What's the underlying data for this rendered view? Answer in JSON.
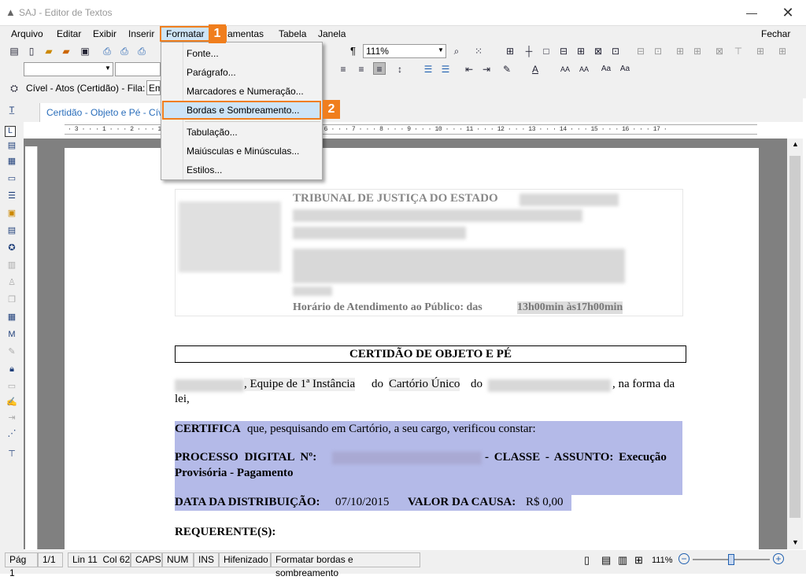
{
  "window": {
    "title": "SAJ - Editor de Textos"
  },
  "menus": [
    "Arquivo",
    "Editar",
    "Exibir",
    "Inserir",
    "Formatar",
    "Ferramentas",
    "Tabela",
    "Janela"
  ],
  "close_doc": "Fechar",
  "toolbar": {
    "zoom": "111%"
  },
  "filter": {
    "label": "Cível - Atos (Certidão) - Fila:",
    "value": "Em"
  },
  "tab": {
    "label": "Certidão - Objeto e Pé - Cíve"
  },
  "format_menu": {
    "items": [
      "Fonte...",
      "Parágrafo...",
      "Marcadores e Numeração...",
      "Bordas e Sombreamento...",
      "Tabulação...",
      "Maiúsculas e Minúsculas...",
      "Estilos..."
    ],
    "highlighted": "Bordas e Sombreamento..."
  },
  "callouts": [
    "1",
    "2"
  ],
  "document": {
    "court": "TRIBUNAL DE JUSTIÇA DO ESTADO",
    "hours_label": "Horário de Atendimento ao Público: das",
    "hours_value": "13h00min às17h00min",
    "title": "CERTIDÃO DE OBJETO E PÉ",
    "p1_a": ", Equipe de 1ª Instância",
    "p1_b": "do",
    "p1_c": "Cartório Único",
    "p1_d": "do",
    "p1_e": ", na forma da",
    "p1_f": "lei,",
    "cert_bold": "CERTIFICA",
    "cert_rest": " que, pesquisando em Cartório, a seu cargo, verificou constar:",
    "proc_label": "PROCESSO DIGITAL Nº:",
    "proc_rest": "- CLASSE - ASSUNTO: Execução",
    "proc_line2": "Provisória - Pagamento",
    "dist_label": "DATA DA DISTRIBUIÇÃO:",
    "dist_value": " 07/10/2015",
    "valor_label": "VALOR DA CAUSA:",
    "valor_value": " R$ 0,00",
    "req": "REQUERENTE(S):"
  },
  "status": {
    "page": "Pág 1",
    "pages": "1/1",
    "linecol": "Lin 11  Col 62",
    "caps": "CAPS",
    "num": "NUM",
    "ins": "INS",
    "hyph": "Hifenizado",
    "msg": "Formatar bordas e sombreamento",
    "zoom": "111%"
  }
}
